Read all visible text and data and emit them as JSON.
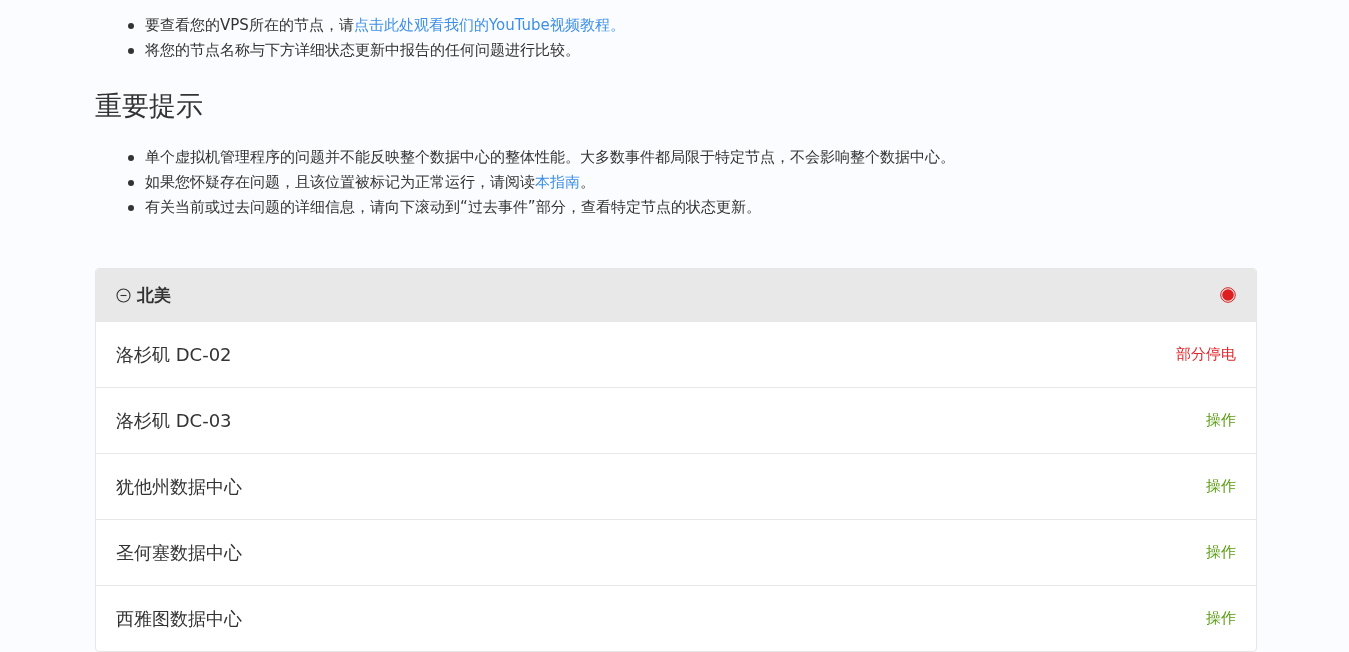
{
  "intro_list": [
    {
      "parts": [
        {
          "kind": "text",
          "text": "要查看您的VPS所在的节点，请"
        },
        {
          "kind": "link",
          "text": "点击此处观看我们的YouTube视频教程。"
        }
      ]
    },
    {
      "parts": [
        {
          "kind": "text",
          "text": "将您的节点名称与下方详细状态更新中报告的任何问题进行比较。"
        }
      ]
    }
  ],
  "notice": {
    "heading": "重要提示",
    "items": [
      {
        "parts": [
          {
            "kind": "text",
            "text": "单个虚拟机管理程序的问题并不能反映整个数据中心的整体性能。大多数事件都局限于特定节点，不会影响整个数据中心。"
          }
        ]
      },
      {
        "parts": [
          {
            "kind": "text",
            "text": "如果您怀疑存在问题，且该位置被标记为正常运行，请阅读"
          },
          {
            "kind": "link",
            "text": "本指南"
          },
          {
            "kind": "text",
            "text": "。"
          }
        ]
      },
      {
        "parts": [
          {
            "kind": "text",
            "text": "有关当前或过去问题的详细信息，请向下滚动到“过去事件”部分，查看特定节点的状态更新。"
          }
        ]
      }
    ]
  },
  "group": {
    "name": "北美",
    "expanded": true,
    "color": "#dd1f1f",
    "rows": [
      {
        "name": "洛杉矶 DC-02",
        "status": "部分停电",
        "color": "#e0262b"
      },
      {
        "name": "洛杉矶 DC-03",
        "status": "操作",
        "color": "#5a9c12"
      },
      {
        "name": "犹他州数据中心",
        "status": "操作",
        "color": "#5a9c12"
      },
      {
        "name": "圣何塞数据中心",
        "status": "操作",
        "color": "#5a9c12"
      },
      {
        "name": "西雅图数据中心",
        "status": "操作",
        "color": "#5a9c12"
      }
    ]
  }
}
